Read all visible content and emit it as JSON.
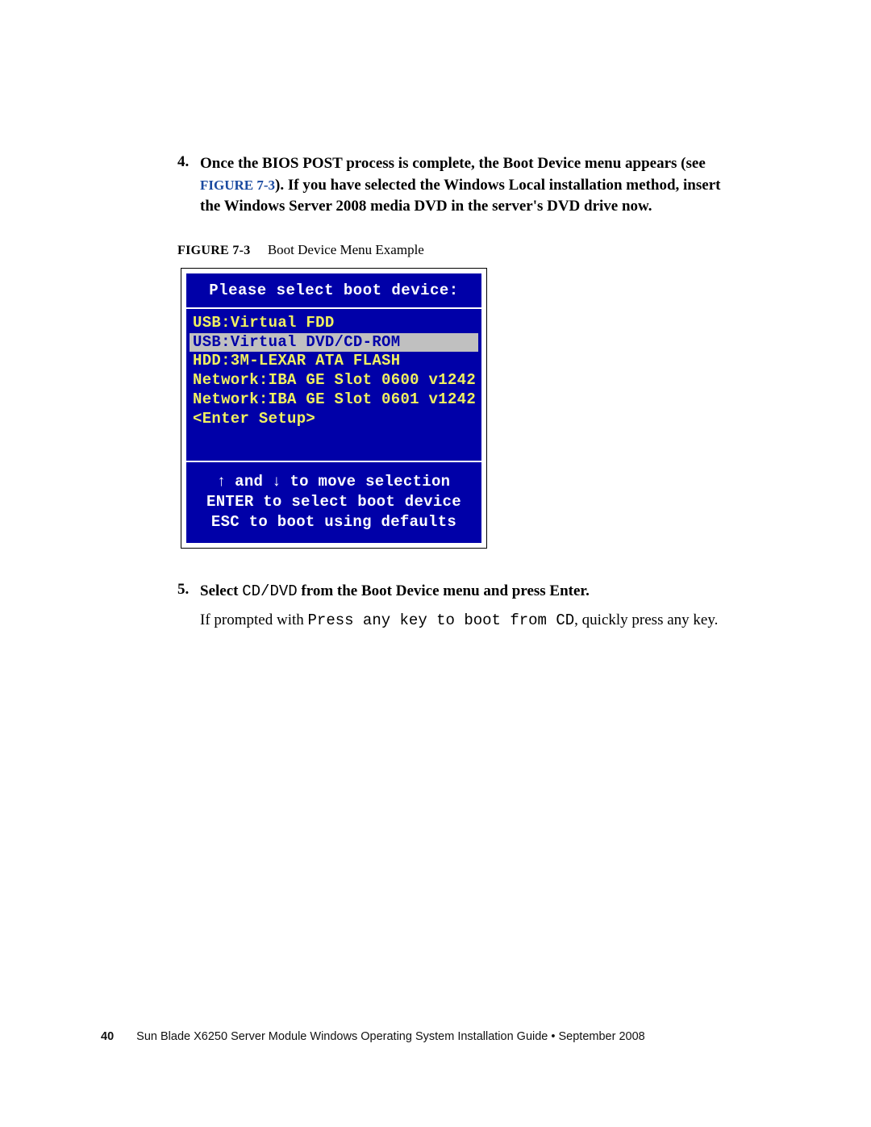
{
  "step4": {
    "number": "4.",
    "part1": "Once the BIOS POST process is complete, the Boot Device menu appears (see ",
    "figref": "FIGURE 7-3",
    "part2": "). If you have selected the Windows Local installation method, insert the Windows Server 2008 media DVD in the server's DVD drive now."
  },
  "figure": {
    "label": "FIGURE 7-3",
    "caption": "Boot Device Menu Example"
  },
  "bios": {
    "title": "Please select boot device:",
    "items": [
      {
        "label": "USB:Virtual FDD",
        "selected": false
      },
      {
        "label": "USB:Virtual DVD/CD-ROM",
        "selected": true
      },
      {
        "label": "HDD:3M-LEXAR ATA FLASH",
        "selected": false
      },
      {
        "label": "Network:IBA GE Slot 0600 v1242",
        "selected": false
      },
      {
        "label": "Network:IBA GE Slot 0601 v1242",
        "selected": false
      },
      {
        "label": "<Enter Setup>",
        "selected": false
      }
    ],
    "hints": {
      "line1_pre": "↑",
      "line1_mid": " and ",
      "line1_post": "↓",
      "line1_tail": " to move selection",
      "line2": "ENTER to select boot device",
      "line3": "ESC to boot using defaults"
    }
  },
  "step5": {
    "number": "5.",
    "part1": "Select ",
    "code": "CD/DVD",
    "part2": " from the Boot Device menu and press Enter."
  },
  "followup": {
    "pre": "If prompted with ",
    "code": "Press any key to boot from CD",
    "post": ", quickly press any key."
  },
  "footer": {
    "page": "40",
    "text": "Sun Blade X6250 Server Module Windows Operating System Installation Guide • September 2008"
  }
}
